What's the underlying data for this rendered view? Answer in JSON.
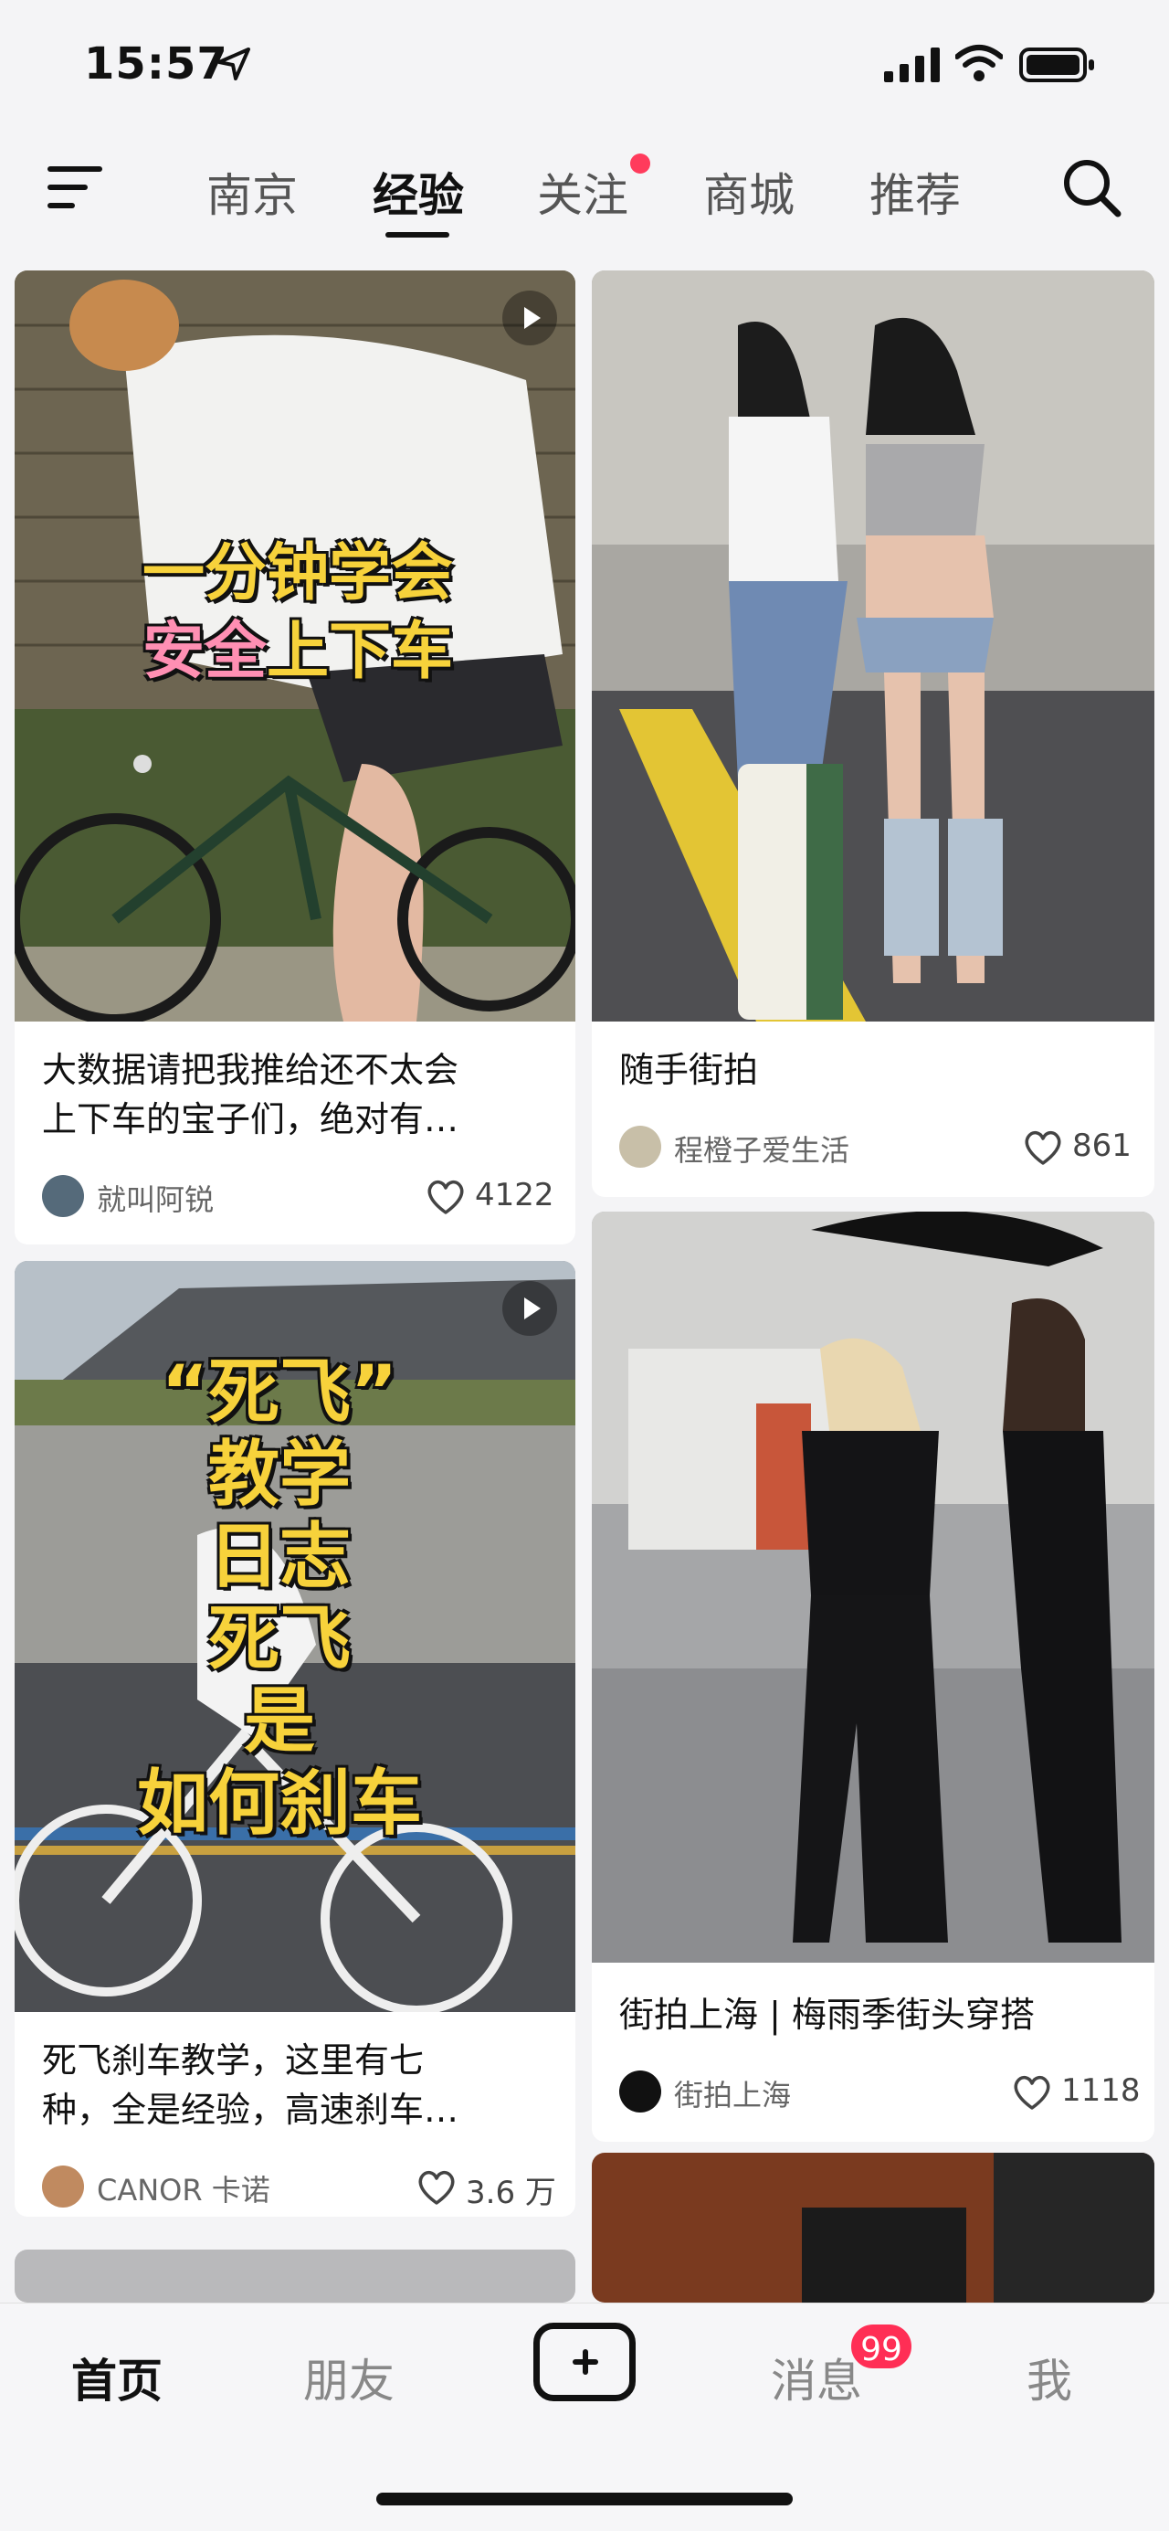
{
  "status_bar": {
    "time": "15:57"
  },
  "nav": {
    "tabs": [
      {
        "label": "南京",
        "active": false
      },
      {
        "label": "经验",
        "active": true
      },
      {
        "label": "关注",
        "active": false,
        "dot": true
      },
      {
        "label": "商城",
        "active": false
      },
      {
        "label": "推荐",
        "active": false
      }
    ]
  },
  "feed": {
    "left": [
      {
        "overlay_lines": [
          "一分钟学会",
          "安全上下车"
        ],
        "caption": "大数据请把我推给还不太会上下车的宝子们，绝对有…",
        "caption_line1": "大数据请把我推给还不太会",
        "caption_line2": "上下车的宝子们，绝对有…",
        "author": "就叫阿锐",
        "likes": "4122",
        "video": true
      },
      {
        "overlay_lines": [
          "“死飞”",
          "教学",
          "日志",
          "死飞",
          "是",
          "如何刹车"
        ],
        "caption_line1": "死飞刹车教学，这里有七",
        "caption_line2": "种，全是经验，高速刹车…",
        "author": "CANOR 卡诺",
        "likes": "3.6 万",
        "video": true
      }
    ],
    "right": [
      {
        "caption": "随手街拍",
        "author": "程橙子爱生活",
        "likes": "861"
      },
      {
        "caption": "街拍上海 | 梅雨季街头穿搭",
        "author": "街拍上海",
        "likes": "1118"
      }
    ]
  },
  "tabbar": {
    "items": [
      "首页",
      "朋友",
      "消息",
      "我"
    ],
    "badge": "99"
  },
  "colors": {
    "accent": "#ff2e55",
    "overlay_yellow": "#f7d23b",
    "overlay_pink": "#ff8fb3"
  }
}
